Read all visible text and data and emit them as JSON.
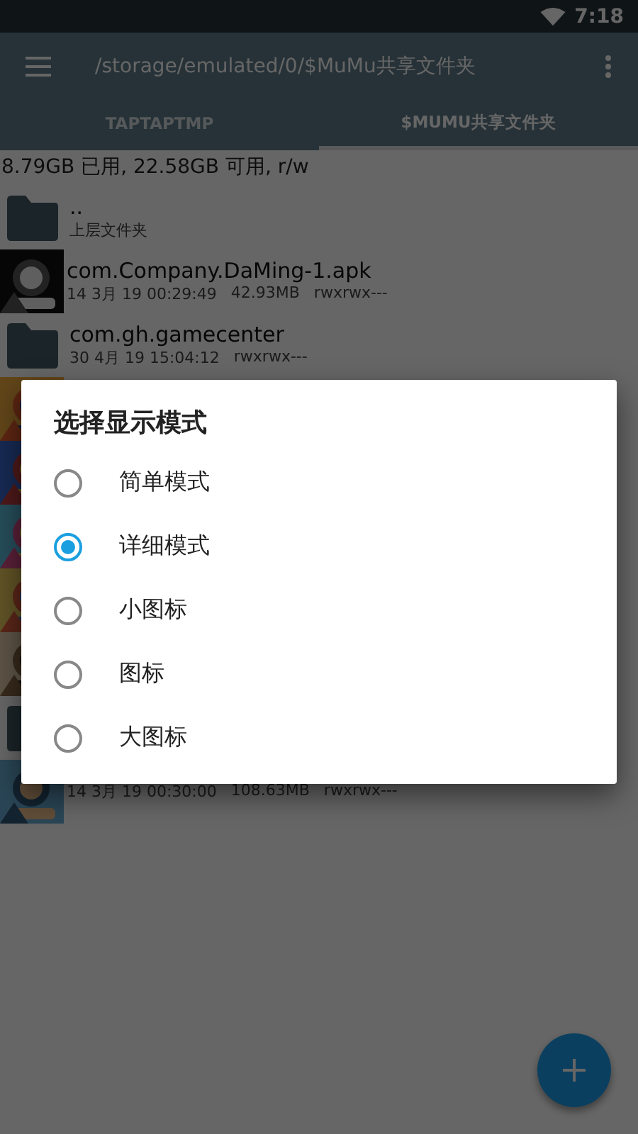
{
  "status_bar": {
    "time": "7:18"
  },
  "app_bar": {
    "path": "/storage/emulated/0/$MuMu共享文件夹"
  },
  "tabs": [
    {
      "label": "TAPTAPTMP",
      "selected": false
    },
    {
      "label": "$MUMU共享文件夹",
      "selected": true
    }
  ],
  "storage_info": "8.79GB 已用, 22.58GB 可用, r/w",
  "files": [
    {
      "kind": "folder",
      "name": "..",
      "details": [
        "上层文件夹"
      ]
    },
    {
      "kind": "picture",
      "name": "com.Company.DaMing-1.apk",
      "details": [
        "14 3月 19 00:29:49",
        "42.93MB",
        "rwxrwx---"
      ]
    },
    {
      "kind": "folder",
      "name": "com.gh.gamecenter",
      "details": [
        "30 4月 19 15:04:12",
        "rwxrwx---"
      ]
    },
    {
      "kind": "picture"
    },
    {
      "kind": "picture"
    },
    {
      "kind": "picture"
    },
    {
      "kind": "picture"
    },
    {
      "kind": "picture"
    },
    {
      "kind": "folder"
    },
    {
      "kind": "picture",
      "details": [
        "14 3月 19 00:30:00",
        "108.63MB",
        "rwxrwx---"
      ]
    }
  ],
  "dialog": {
    "title": "选择显示模式",
    "options": [
      {
        "label": "简单模式",
        "selected": false
      },
      {
        "label": "详细模式",
        "selected": true
      },
      {
        "label": "小图标",
        "selected": false
      },
      {
        "label": "图标",
        "selected": false
      },
      {
        "label": "大图标",
        "selected": false
      }
    ]
  }
}
